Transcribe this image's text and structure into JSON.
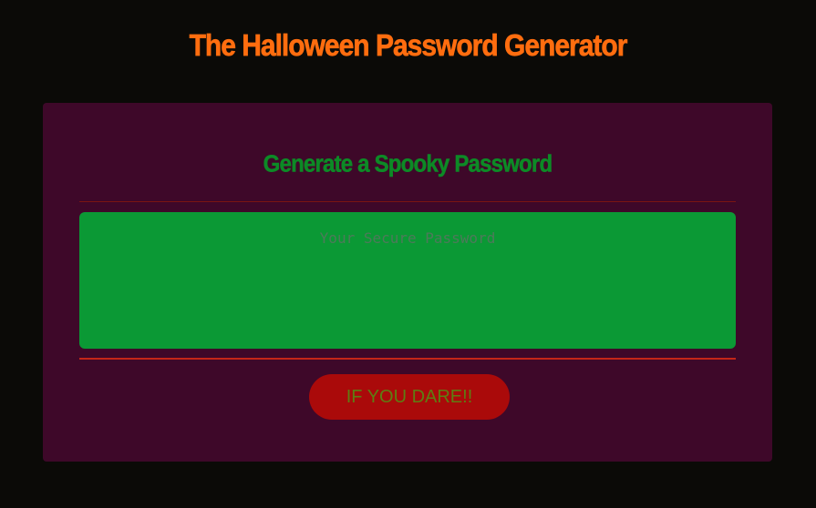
{
  "header": {
    "title": "The Halloween Password Generator"
  },
  "card": {
    "heading": "Generate a Spooky Password",
    "password_field": {
      "value": "",
      "placeholder": "Your Secure Password"
    },
    "generate_button_label": "IF YOU DARE!!"
  },
  "colors": {
    "page_background": "#0b0a07",
    "title": "#ff6d0f",
    "card_background": "#3e0829",
    "card_heading": "#0d8a26",
    "password_field_background": "#0b9935",
    "divider": "#c42618",
    "button_background": "#aa0a0a",
    "button_text": "#5e7d12"
  }
}
